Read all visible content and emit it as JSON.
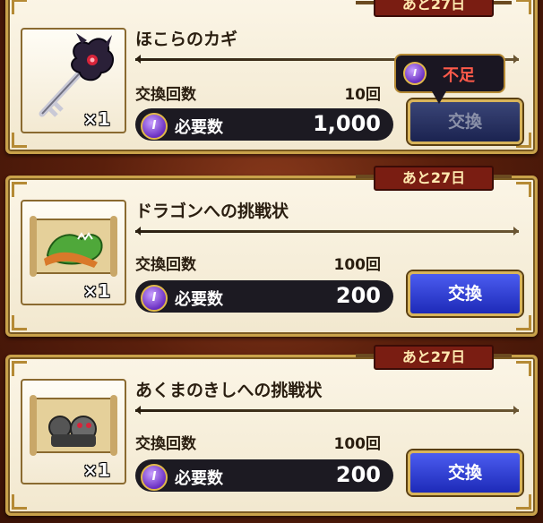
{
  "cards": [
    {
      "deadline": "あと27日",
      "name": "ほこらのカギ",
      "qty": "×1",
      "count_label": "交換回数",
      "count_value": "10回",
      "cost_label": "必要数",
      "cost_value": "1,000",
      "button_label": "交換",
      "button_enabled": false,
      "icon": "key-icon",
      "tooltip": {
        "text": "不足",
        "medal": "I"
      }
    },
    {
      "deadline": "あと27日",
      "name": "ドラゴンへの挑戦状",
      "qty": "×1",
      "count_label": "交換回数",
      "count_value": "100回",
      "cost_label": "必要数",
      "cost_value": "200",
      "button_label": "交換",
      "button_enabled": true,
      "icon": "dragon-scroll-icon"
    },
    {
      "deadline": "あと27日",
      "name": "あくまのきしへの挑戦状",
      "qty": "×1",
      "count_label": "交換回数",
      "count_value": "100回",
      "cost_label": "必要数",
      "cost_value": "200",
      "button_label": "交換",
      "button_enabled": true,
      "icon": "demon-knight-scroll-icon"
    }
  ],
  "medal_letter": "I",
  "colors": {
    "button": "#2a38d0",
    "deadline_bg": "#7a1d12",
    "tooltip_text": "#ff5a4a"
  }
}
